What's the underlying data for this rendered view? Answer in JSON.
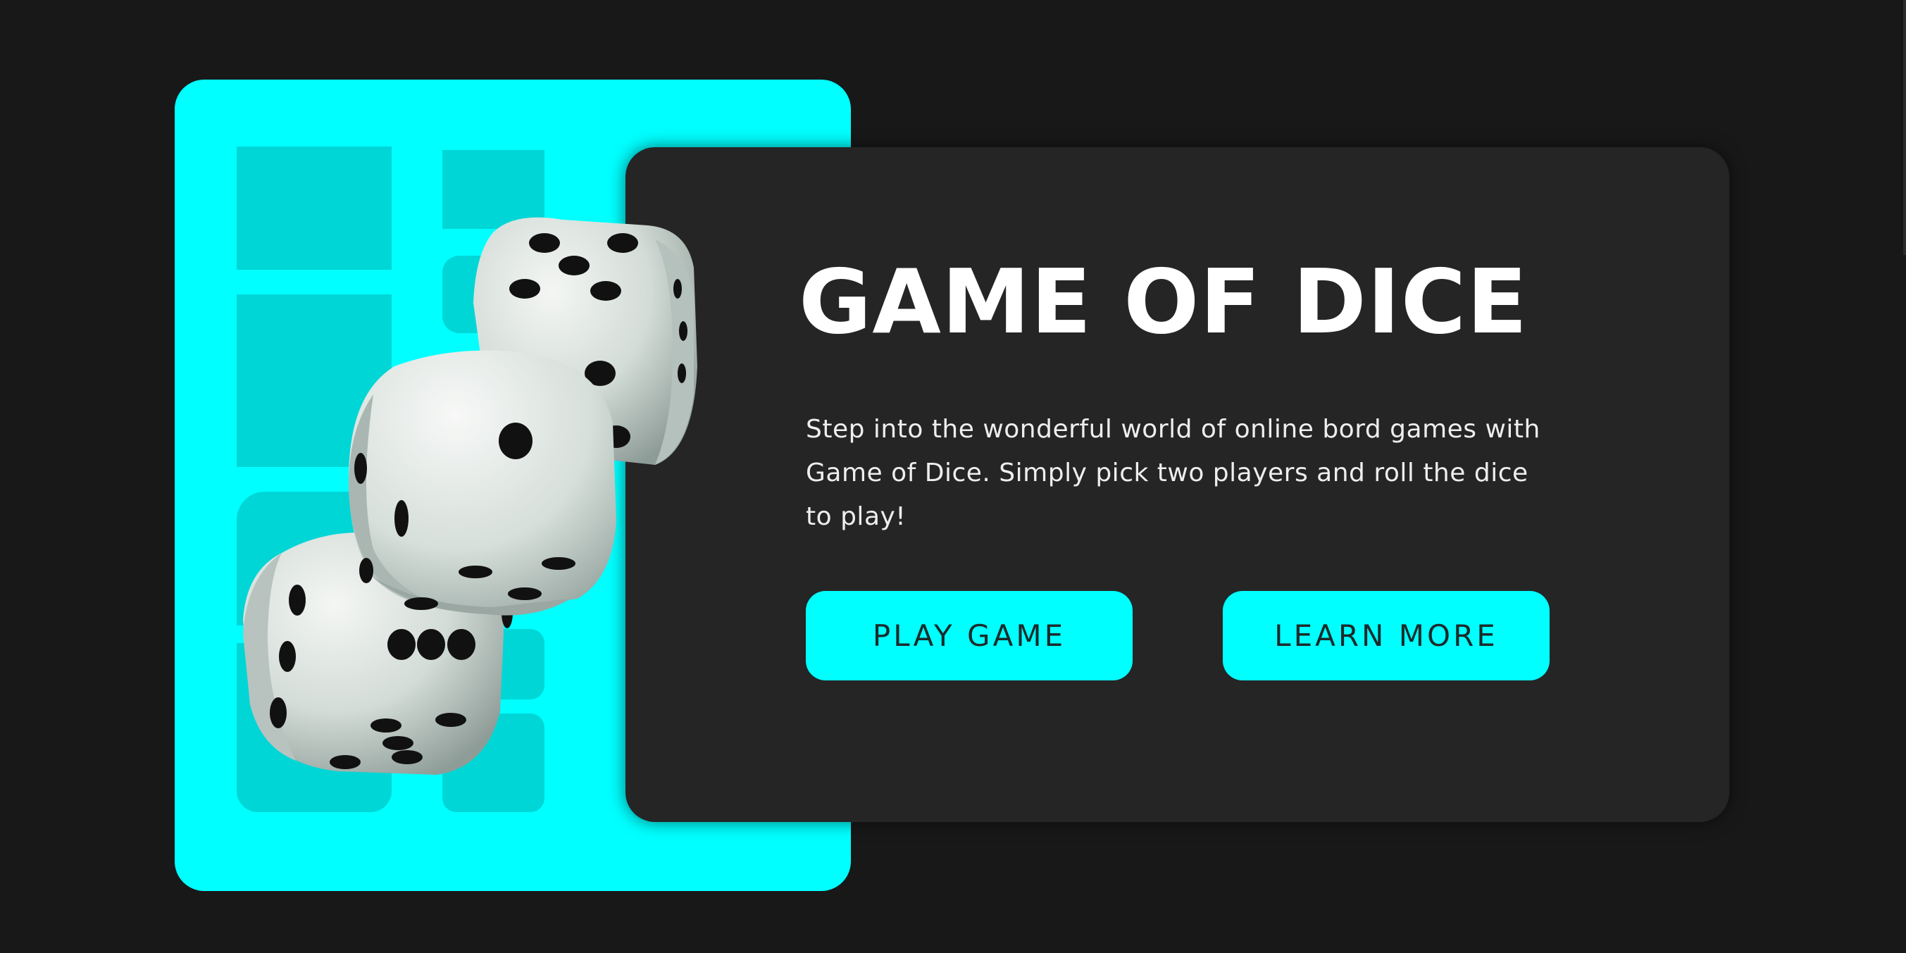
{
  "hero": {
    "title": "GAME OF DICE",
    "description": "Step into the wonderful world of online bord games with Game of Dice. Simply pick two players and roll the dice to play!",
    "buttons": {
      "play_label": "PLAY GAME",
      "learn_label": "LEARN MORE"
    }
  },
  "colors": {
    "background": "#181818",
    "accent": "#00ffff",
    "card": "#252525",
    "title": "#ffffff"
  },
  "icons": {
    "dice": "dice-illustration"
  }
}
